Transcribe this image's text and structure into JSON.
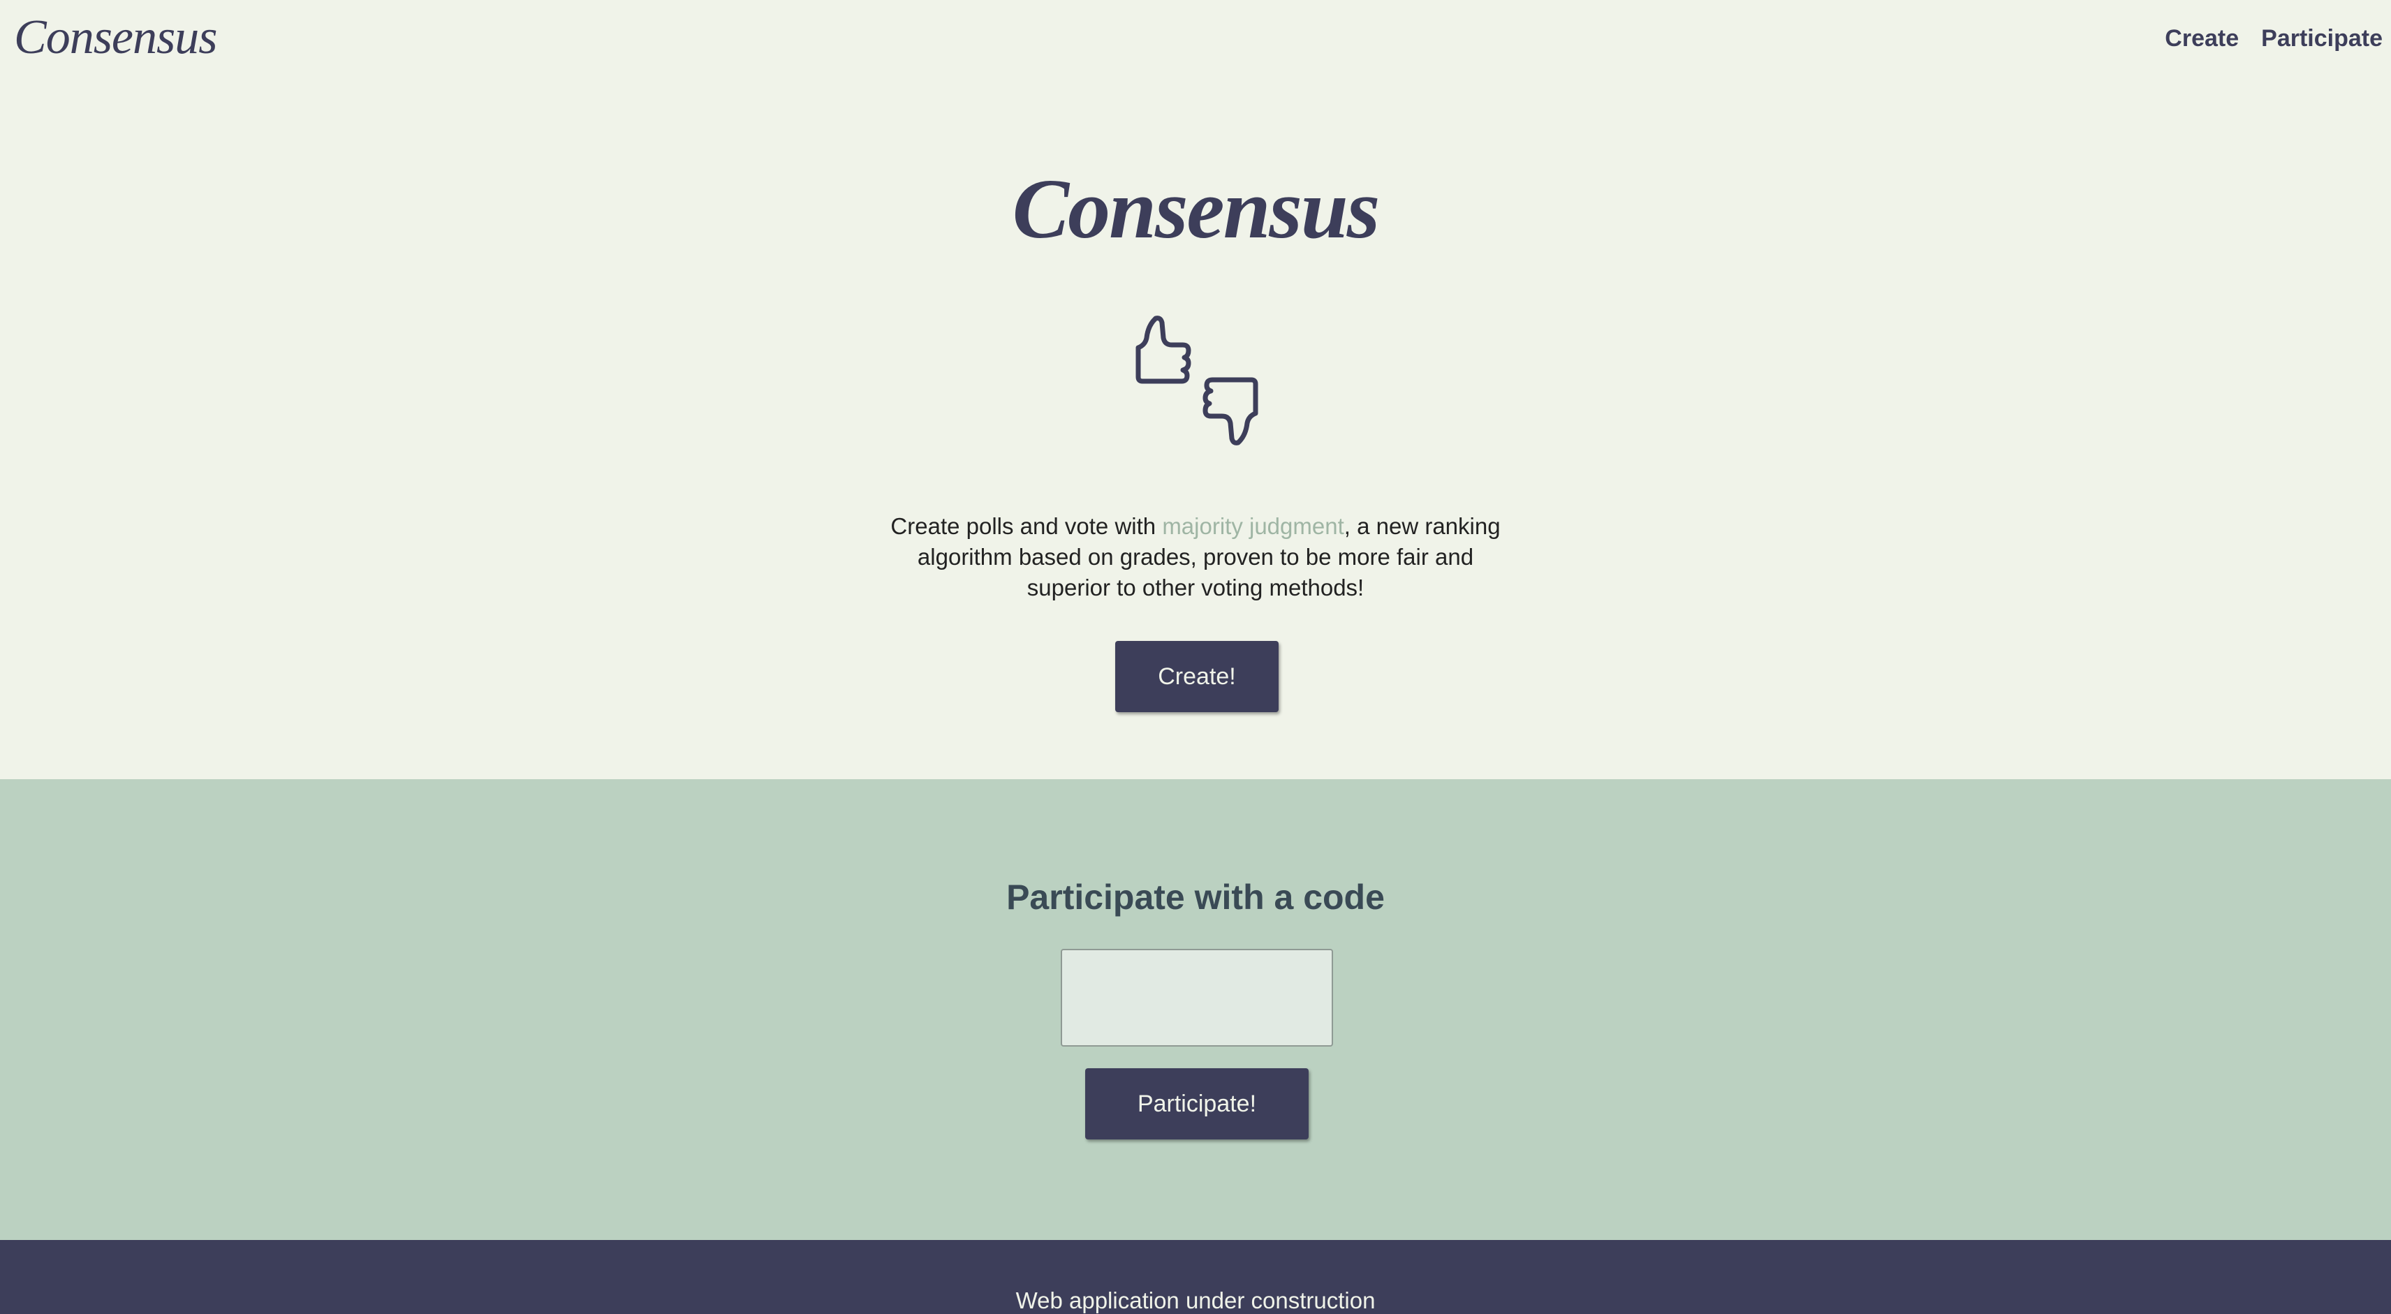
{
  "header": {
    "logo": "Consensus",
    "nav": [
      {
        "label": "Create"
      },
      {
        "label": "Participate"
      }
    ]
  },
  "hero": {
    "title": "Consensus",
    "icon": "thumbs-up-down-icon",
    "description_before": "Create polls and vote with ",
    "description_link": "majority judgment",
    "description_after": ", a new ranking algorithm based on grades, proven to be more fair and superior to other voting methods!",
    "create_button": "Create!"
  },
  "participate": {
    "title": "Participate with a code",
    "code_input_value": "",
    "button": "Participate!"
  },
  "footer": {
    "text": "Web application under construction"
  },
  "colors": {
    "background": "#f0f3e9",
    "primary": "#3d3e5a",
    "section": "#bbd1c1",
    "link": "#9fb5a4"
  }
}
